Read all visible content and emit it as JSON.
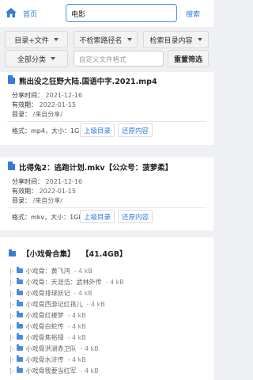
{
  "topbar": {
    "home_label": "首页",
    "search_value": "电影",
    "search_btn": "搜索"
  },
  "filters": {
    "row1": [
      "目录+文件",
      "不检索路径名",
      "检索目录内容"
    ],
    "row2_label": "全部分类",
    "custom_placeholder": "自定义文件格式",
    "reset_label": "重置筛选"
  },
  "results": [
    {
      "title": "熊出没之狂野大陆.国语中字.2021.mp4",
      "share_label": "分享时间：",
      "share_value": "2021-12-16",
      "valid_label": "有效期：",
      "valid_value": "2022-01-15",
      "dir_label": "目录：",
      "dir_value": "/来自分享/",
      "fmt_label": "格式：mp4，大小：1GB",
      "up_btn": "上级目录",
      "restore_btn": "还原内容"
    },
    {
      "title": "比得兔2：逃跑计划.mkv【公众号：菠萝柔】",
      "share_label": "分享时间：",
      "share_value": "2021-12-16",
      "valid_label": "有效期：",
      "valid_value": "2022-01-15",
      "dir_label": "目录：",
      "dir_value": "/来自分享/",
      "fmt_label": "格式：mkv，大小：1GB",
      "up_btn": "上级目录",
      "restore_btn": "还原内容"
    }
  ],
  "package": {
    "title": "【小戏骨合集】",
    "size": "【41.4GB】",
    "items": [
      {
        "prefix": "|-",
        "name": "小戏骨：黄飞鸿",
        "size": "- 4 kB"
      },
      {
        "prefix": "|-",
        "name": "小戏骨：天涯浩：武林外传",
        "size": "- 4 kB"
      },
      {
        "prefix": "|-",
        "name": "小戏骨排球妖记",
        "size": "- 4 kB"
      },
      {
        "prefix": "|-",
        "name": "小戏骨西游记红孩儿",
        "size": "- 4 kB"
      },
      {
        "prefix": "|-",
        "name": "小戏骨红楼梦",
        "size": "- 4 kB"
      },
      {
        "prefix": "|-",
        "name": "小戏骨白蛇传",
        "size": "- 4 kB"
      },
      {
        "prefix": "|-",
        "name": "小戏骨焦裕禄",
        "size": "- 4 kB"
      },
      {
        "prefix": "|-",
        "name": "小戏骨洪湖赤卫队",
        "size": "- 4 kB"
      },
      {
        "prefix": "|-",
        "name": "小戏骨水浒传",
        "size": "- 4 kB"
      },
      {
        "prefix": "|-",
        "name": "小戏骨我要当红军",
        "size": "- 4 kB"
      }
    ]
  },
  "colors": {
    "accent": "#2a7de1",
    "icon": "#3a7bd5",
    "background": "#eef0f4"
  },
  "icons": {
    "home": "home-icon",
    "file": "file-icon",
    "folder": "folder-icon"
  }
}
